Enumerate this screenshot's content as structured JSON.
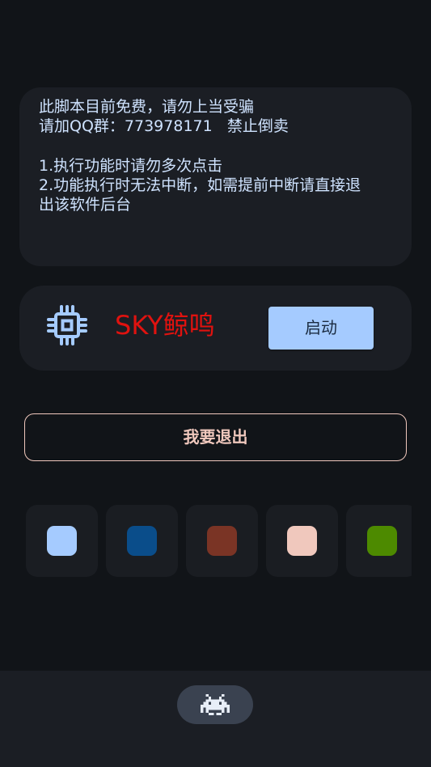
{
  "notice": {
    "lines": [
      "此脚本目前免费，请勿上当受骗",
      "请加QQ群：773978171   禁止倒卖",
      "",
      "1.执行功能时请勿多次点击",
      "2.功能执行时无法中断，如需提前中断请直接退",
      "出该软件后台"
    ]
  },
  "tool": {
    "icon": "cpu-chip-icon",
    "title": "SKY鲸鸣",
    "title_color": "#e0120f",
    "start_label": "启动"
  },
  "exit": {
    "label": "我要退出"
  },
  "theme_swatches": [
    "#a5cbff",
    "#0a4d8a",
    "#7a3425",
    "#f0c8bd",
    "#4d8a00"
  ],
  "bottom_nav": {
    "icon": "space-invader-icon"
  },
  "colors": {
    "background": "#111418",
    "card": "#1b1e24",
    "accent": "#a5cbff",
    "notice_text": "#cfe3ff",
    "exit_outline": "#f0c8bd"
  }
}
